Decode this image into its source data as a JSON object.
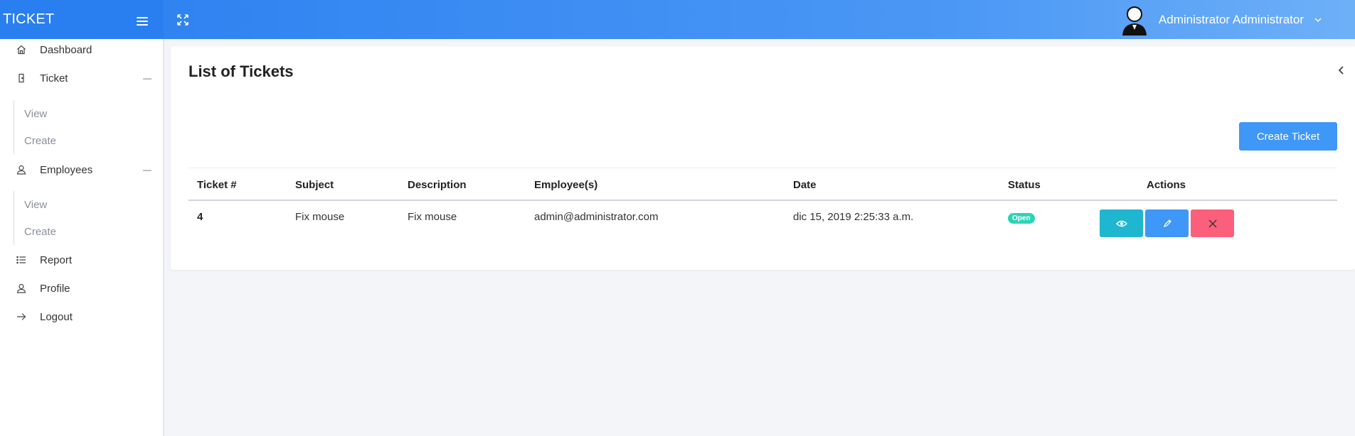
{
  "app": {
    "brand": "TICKET"
  },
  "header": {
    "user_name": "Administrator Administrator"
  },
  "sidebar": {
    "items": [
      {
        "label": "Dashboard",
        "icon": "home-icon"
      },
      {
        "label": "Ticket",
        "icon": "door-icon"
      },
      {
        "label": "Employees",
        "icon": "user-icon"
      },
      {
        "label": "Report",
        "icon": "list-icon"
      },
      {
        "label": "Profile",
        "icon": "user-icon"
      },
      {
        "label": "Logout",
        "icon": "arrow-right-icon"
      }
    ],
    "ticket_sub": [
      "View",
      "Create"
    ],
    "employees_sub": [
      "View",
      "Create"
    ],
    "collapse_symbol": "—"
  },
  "main": {
    "title": "List of Tickets",
    "create_button": "Create Ticket",
    "columns": [
      "Ticket #",
      "Subject",
      "Description",
      "Employee(s)",
      "Date",
      "Status",
      "Actions"
    ],
    "rows": [
      {
        "ticket": "4",
        "subject": "Fix mouse",
        "description": "Fix mouse",
        "employee": "admin@administrator.com",
        "date": "dic 15, 2019 2:25:33 a.m.",
        "status": "Open"
      }
    ]
  },
  "colors": {
    "topbar": "#2a7ff0",
    "primary": "#3f97f7",
    "view": "#1fb6cf",
    "delete": "#fb5f7c",
    "status_open": "#2ed3b7"
  }
}
